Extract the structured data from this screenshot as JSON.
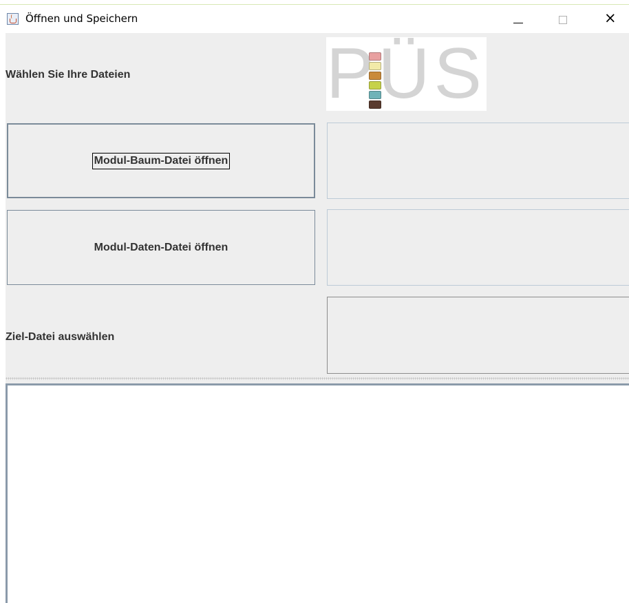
{
  "window": {
    "title": "Öffnen und Speichern",
    "close_glyph": "×",
    "icons": {
      "app": "java-coffee-cup-icon",
      "minimize": "minimize-icon",
      "maximize": "maximize-icon",
      "close": "close-icon"
    }
  },
  "header": {
    "instruction": "Wählen Sie Ihre Dateien",
    "logo": {
      "letters": "PÜS",
      "chip_colors": [
        "#e8a0a0",
        "#f2eaa8",
        "#c98a3a",
        "#c6d24a",
        "#6fb3b8",
        "#5a3b2e"
      ]
    }
  },
  "rows": {
    "tree_button_label": "Modul-Baum-Datei öffnen",
    "data_button_label": "Modul-Daten-Datei öffnen",
    "target_label": "Ziel-Datei auswählen"
  },
  "colors": {
    "panel_background": "#eeeeee",
    "button_border": "#7a8a99",
    "field_border": "#bccad6",
    "text": "#333333"
  }
}
